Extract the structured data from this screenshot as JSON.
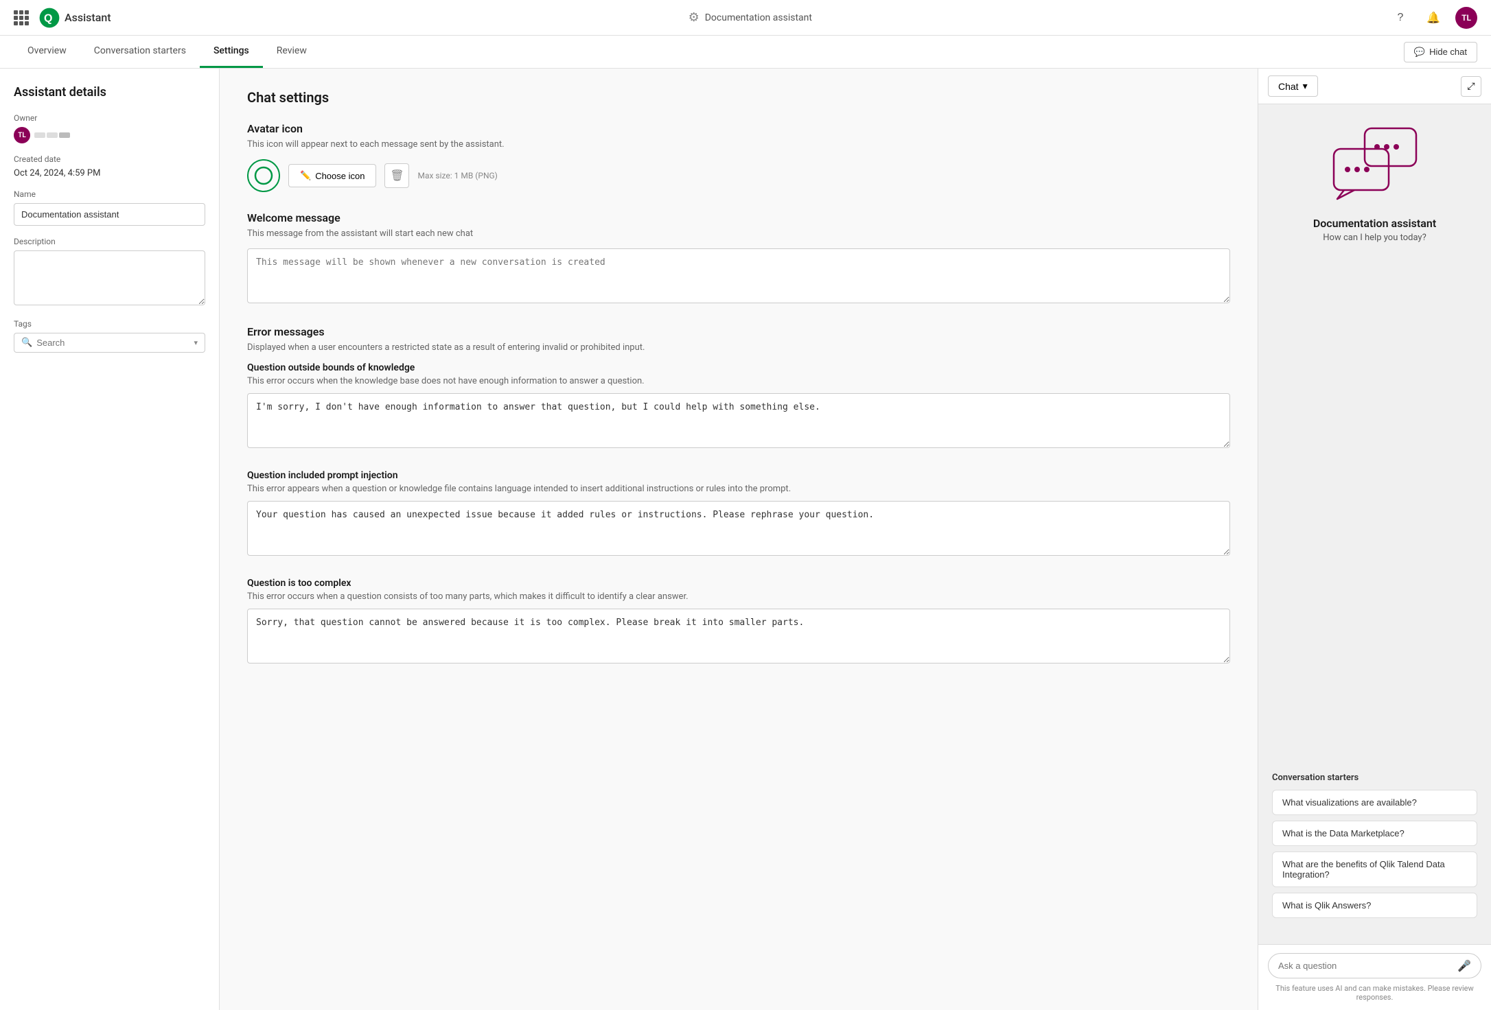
{
  "app": {
    "title": "Assistant",
    "logo_text": "Qlik"
  },
  "nav": {
    "assistant_name": "Documentation assistant",
    "help_icon": "?",
    "bell_icon": "🔔",
    "avatar_initials": "TL",
    "hide_chat_label": "Hide chat"
  },
  "tabs": [
    {
      "label": "Overview",
      "active": false
    },
    {
      "label": "Conversation starters",
      "active": false
    },
    {
      "label": "Settings",
      "active": true
    },
    {
      "label": "Review",
      "active": false
    }
  ],
  "sidebar": {
    "title": "Assistant details",
    "owner_label": "Owner",
    "owner_initials": "TL",
    "created_label": "Created date",
    "created_date": "Oct 24, 2024, 4:59 PM",
    "name_label": "Name",
    "name_value": "Documentation assistant",
    "description_label": "Description",
    "description_value": "",
    "tags_label": "Tags",
    "tags_search_placeholder": "Search"
  },
  "main": {
    "section_title": "Chat settings",
    "avatar_icon": {
      "title": "Avatar icon",
      "description": "This icon will appear next to each message sent by the assistant.",
      "choose_icon_label": "Choose icon",
      "max_size_label": "Max size: 1 MB (PNG)"
    },
    "welcome_message": {
      "title": "Welcome message",
      "description": "This message from the assistant will start each new chat",
      "placeholder": "This message will be shown whenever a new conversation is created"
    },
    "error_messages": {
      "title": "Error messages",
      "description": "Displayed when a user encounters a restricted state as a result of entering invalid or prohibited input.",
      "errors": [
        {
          "label": "Question outside bounds of knowledge",
          "description": "This error occurs when the knowledge base does not have enough information to answer a question.",
          "value": "I'm sorry, I don't have enough information to answer that question, but I could help with something else."
        },
        {
          "label": "Question included prompt injection",
          "description": "This error appears when a question or knowledge file contains language intended to insert additional instructions or rules into the prompt.",
          "value": "Your question has caused an unexpected issue because it added rules or instructions. Please rephrase your question."
        },
        {
          "label": "Question is too complex",
          "description": "This error occurs when a question consists of too many parts, which makes it difficult to identify a clear answer.",
          "value": "Sorry, that question cannot be answered because it is too complex. Please break it into smaller parts."
        }
      ]
    }
  },
  "chat_panel": {
    "title": "Chat",
    "chevron": "▾",
    "bot_name": "Documentation assistant",
    "bot_subtitle": "How can I help you today?",
    "starters_label": "Conversation starters",
    "starters": [
      "What visualizations are available?",
      "What is the Data Marketplace?",
      "What are the benefits of Qlik Talend Data Integration?",
      "What is Qlik Answers?"
    ],
    "input_placeholder": "Ask a question",
    "disclaimer": "This feature uses AI and can make mistakes. Please review responses."
  }
}
